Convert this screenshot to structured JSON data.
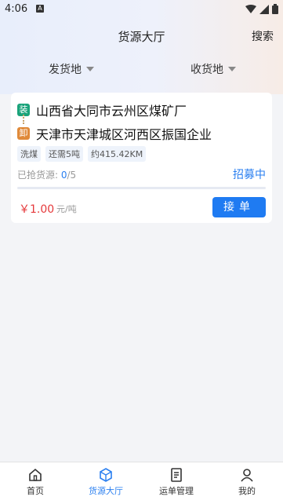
{
  "status": {
    "time": "4:06",
    "a_label": "A"
  },
  "header": {
    "title": "货源大厅",
    "search_label": "搜索"
  },
  "filters": {
    "origin_label": "发货地",
    "dest_label": "收货地"
  },
  "card": {
    "load_tag": "装",
    "unload_tag": "卸",
    "from": "山西省大同市云州区煤矿厂",
    "to": "天津市天津城区河西区振国企业",
    "chips": [
      "洗煤",
      "还需5吨",
      "约415.42KM"
    ],
    "grabbed_label": "已抢货源:",
    "grabbed_count": "0",
    "grabbed_total": "/5",
    "grabbed_fraction": 0,
    "status": "招募中",
    "price": "￥1.00",
    "unit": "元/吨",
    "accept_label": "接单"
  },
  "tabs": [
    {
      "label": "首页",
      "icon": "home-icon"
    },
    {
      "label": "货源大厅",
      "icon": "cube-icon",
      "active": true
    },
    {
      "label": "运单管理",
      "icon": "document-icon"
    },
    {
      "label": "我的",
      "icon": "user-icon"
    }
  ],
  "colors": {
    "accent": "#1f7bf2",
    "price": "#e5393b",
    "load": "#1aa37a",
    "unload": "#e08a3a"
  }
}
